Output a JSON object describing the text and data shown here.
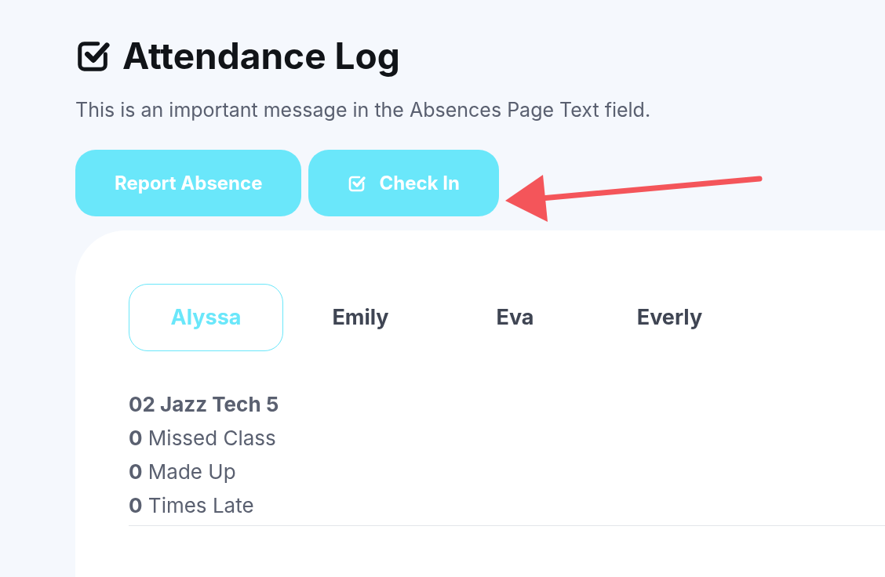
{
  "header": {
    "title": "Attendance Log",
    "message": "This is an important message in the Absences Page Text field."
  },
  "buttons": [
    {
      "label": "Report Absence",
      "icon": false
    },
    {
      "label": "Check In",
      "icon": true
    }
  ],
  "tabs": [
    {
      "label": "Alyssa",
      "selected": true
    },
    {
      "label": "Emily",
      "selected": false
    },
    {
      "label": "Eva",
      "selected": false
    },
    {
      "label": "Everly",
      "selected": false
    }
  ],
  "class_summary": {
    "title": "02 Jazz Tech 5",
    "stats": [
      "**0** Missed Class",
      "**0** Made Up",
      "**0** Times Late"
    ]
  }
}
